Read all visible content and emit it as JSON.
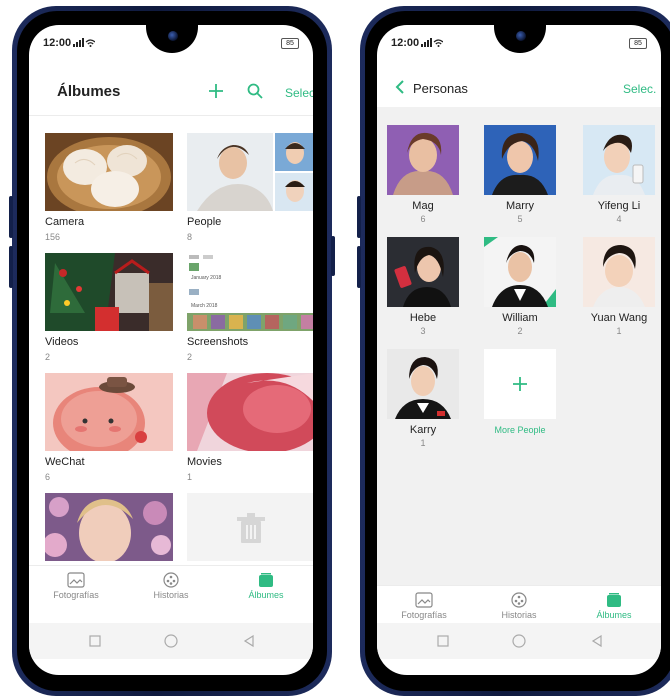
{
  "status": {
    "time": "12:00",
    "battery": "85"
  },
  "albums_screen": {
    "title": "Álbumes",
    "select_label": "Selec.",
    "albums": [
      {
        "name": "Camera",
        "count": "156"
      },
      {
        "name": "People",
        "count": "8"
      },
      {
        "name": "Videos",
        "count": "2"
      },
      {
        "name": "Screenshots",
        "count": "2"
      },
      {
        "name": "WeChat",
        "count": "6"
      },
      {
        "name": "Movies",
        "count": "1"
      }
    ],
    "screenshot_thumb_labels": [
      "January 2018",
      "March 2018"
    ],
    "tabs": [
      {
        "label": "Fotografías",
        "icon": "photos-icon",
        "active": false
      },
      {
        "label": "Historias",
        "icon": "stories-icon",
        "active": false
      },
      {
        "label": "Álbumes",
        "icon": "albums-icon",
        "active": true
      }
    ]
  },
  "people_screen": {
    "title": "Personas",
    "select_label": "Selec.",
    "people": [
      {
        "name": "Mag",
        "count": "6"
      },
      {
        "name": "Marry",
        "count": "5"
      },
      {
        "name": "Yifeng Li",
        "count": "4"
      },
      {
        "name": "Hebe",
        "count": "3"
      },
      {
        "name": "William",
        "count": "2"
      },
      {
        "name": "Yuan Wang",
        "count": "1"
      },
      {
        "name": "Karry",
        "count": "1"
      }
    ],
    "more_label": "More People",
    "tabs": [
      {
        "label": "Fotografías",
        "icon": "photos-icon",
        "active": false
      },
      {
        "label": "Historias",
        "icon": "stories-icon",
        "active": false
      },
      {
        "label": "Álbumes",
        "icon": "albums-icon",
        "active": true
      }
    ]
  },
  "colors": {
    "accent": "#2fbb83",
    "frame": "#1d2b5c"
  }
}
